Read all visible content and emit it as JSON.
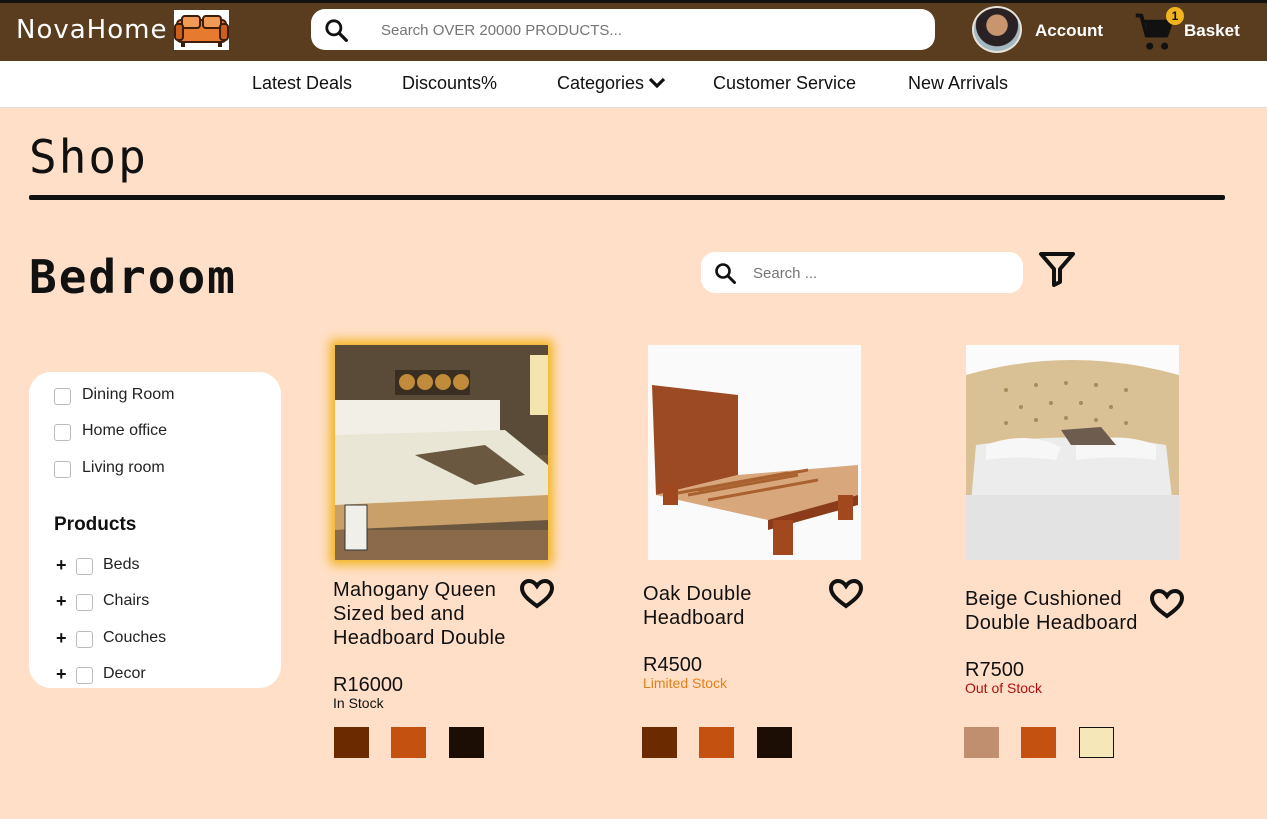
{
  "header": {
    "brand": "NovaHome",
    "search_placeholder": "Search OVER 20000 PRODUCTS...",
    "account_label": "Account",
    "basket_label": "Basket",
    "basket_count": "1"
  },
  "nav": {
    "items": [
      "Latest Deals",
      "Discounts%",
      "Categories",
      "Customer Service",
      "New Arrivals"
    ]
  },
  "page": {
    "title": "Shop",
    "section_title": "Bedroom",
    "search_placeholder": "Search ..."
  },
  "sidebar": {
    "rooms": [
      "Dining Room",
      "Home office",
      "Living room"
    ],
    "products_heading": "Products",
    "products": [
      "Beds",
      "Chairs",
      "Couches",
      "Decor"
    ]
  },
  "products": [
    {
      "name_lines": [
        "Mahogany Queen",
        "Sized bed and",
        "Headboard Double"
      ],
      "price": "R16000",
      "stock": "In Stock",
      "stock_color": "#111111",
      "swatches": [
        "#6b2a00",
        "#c4510f",
        "#1c0d05"
      ]
    },
    {
      "name_lines": [
        "Oak Double",
        "Headboard"
      ],
      "price": "R4500",
      "stock": "Limited Stock",
      "stock_color": "#e0801a",
      "swatches": [
        "#6b2a00",
        "#c4510f",
        "#1c0d05"
      ]
    },
    {
      "name_lines": [
        "Beige Cushioned",
        "Double Headboard"
      ],
      "price": "R7500",
      "stock": "Out of Stock",
      "stock_color": "#b01010",
      "swatches": [
        "#c08f6f",
        "#c4510f",
        "#f6e7b9"
      ]
    }
  ],
  "colors": {
    "header_bg": "#5a3d1f",
    "page_bg": "#ffdfc8",
    "highlight_glow": "#f2b41e"
  }
}
